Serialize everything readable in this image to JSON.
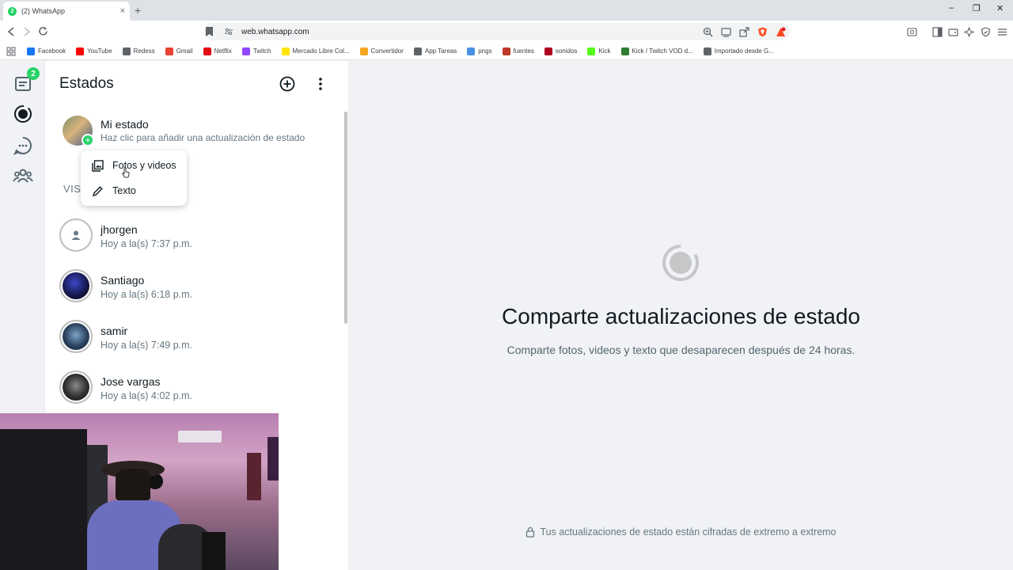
{
  "browser": {
    "tab_title": "(2) WhatsApp",
    "tab_badge": "2",
    "tab_close": "×",
    "new_tab": "+",
    "url": "web.whatsapp.com",
    "window_minimize": "–",
    "window_restore": "❐",
    "window_close": "✕",
    "bookmarks": [
      {
        "label": "Facebook",
        "color": "#1877f2"
      },
      {
        "label": "YouTube",
        "color": "#ff0000"
      },
      {
        "label": "Redess",
        "color": "#5f6368"
      },
      {
        "label": "Gmail",
        "color": "#ea4335"
      },
      {
        "label": "Netflix",
        "color": "#e50914"
      },
      {
        "label": "Twitch",
        "color": "#9146ff"
      },
      {
        "label": "Mercado Libre Col...",
        "color": "#ffe600"
      },
      {
        "label": "Convertidor",
        "color": "#f5a623"
      },
      {
        "label": "App Tareas",
        "color": "#5f6368"
      },
      {
        "label": "pngs",
        "color": "#4a90e2"
      },
      {
        "label": "fuentes",
        "color": "#c0392b"
      },
      {
        "label": "sonidos",
        "color": "#b00020"
      },
      {
        "label": "Kick",
        "color": "#53fc18"
      },
      {
        "label": "Kick / Twitch VOD d...",
        "color": "#2e7d32"
      },
      {
        "label": "Importado desde G...",
        "color": "#5f6368"
      }
    ]
  },
  "rail": {
    "chats_badge": "2"
  },
  "status_panel": {
    "title": "Estados",
    "my_status": {
      "name": "Mi estado",
      "hint": "Haz clic para añadir una actualización de estado"
    },
    "section_label": "VIST",
    "menu": [
      {
        "label": "Fotos y videos"
      },
      {
        "label": "Texto"
      }
    ],
    "contacts": [
      {
        "name": "jhorgen",
        "time": "Hoy a la(s) 7:37 p.m."
      },
      {
        "name": "Santiago",
        "time": "Hoy a la(s) 6:18 p.m."
      },
      {
        "name": "samir",
        "time": "Hoy a la(s) 7:49 p.m."
      },
      {
        "name": "Jose vargas",
        "time": "Hoy a la(s) 4:02 p.m."
      }
    ]
  },
  "main": {
    "title": "Comparte actualizaciones de estado",
    "subtitle": "Comparte fotos, videos y texto que desaparecen después de 24 horas.",
    "encryption": "Tus actualizaciones de estado están cifradas de extremo a extremo"
  },
  "colors": {
    "accent": "#25d366",
    "panel_bg": "#f0f2f5"
  }
}
